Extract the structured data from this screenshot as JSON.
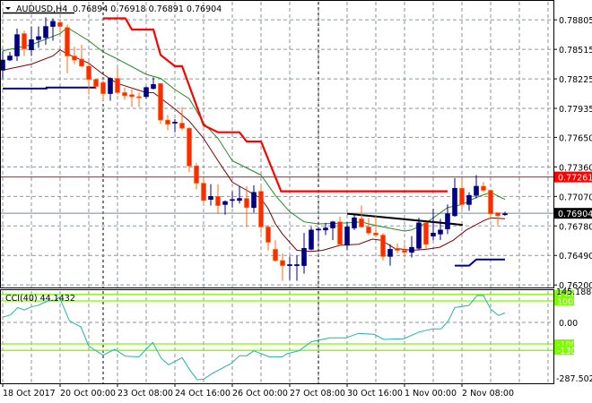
{
  "header": {
    "symbol": "AUDUSD,H4",
    "ohlc": "0.76894 0.76918 0.76891 0.76904"
  },
  "colors": {
    "bull": "#000080",
    "bear": "#ff2a00",
    "bear_wick": "#ff6a10",
    "ma_fast": "#1f8a1f",
    "ma_slow": "#7a0000",
    "resistance_step": "#ff0000",
    "support_step": "#00008b",
    "cci_line": "#20b2aa",
    "cci_levels": "#7cfc00"
  },
  "chart_data": [
    {
      "type": "candlestick",
      "title": "AUDUSD,H4",
      "price_axis_ticks": [
        "0.78805",
        "0.78515",
        "0.78225",
        "0.77935",
        "0.77650",
        "0.77360",
        "0.77070",
        "0.76780",
        "0.76490",
        "0.76200"
      ],
      "ylim": [
        0.762,
        0.79
      ],
      "x_tick_labels": [
        "18 Oct 2017",
        "20 Oct 00:00",
        "23 Oct 08:00",
        "24 Oct 16:00",
        "26 Oct 00:00",
        "27 Oct 08:00",
        "30 Oct 16:00",
        "1 Nov 00:00",
        "2 Nov 08:00"
      ],
      "x_tick_bars": [
        0,
        8,
        16,
        24,
        32,
        40,
        48,
        56,
        64
      ],
      "candles_ohlc": [
        [
          0.7831,
          0.785,
          0.7823,
          0.7841
        ],
        [
          0.7841,
          0.7849,
          0.784,
          0.7845
        ],
        [
          0.7845,
          0.7872,
          0.784,
          0.7866
        ],
        [
          0.7867,
          0.787,
          0.7845,
          0.7852
        ],
        [
          0.7851,
          0.7874,
          0.7845,
          0.7861
        ],
        [
          0.7861,
          0.7874,
          0.7853,
          0.7864
        ],
        [
          0.7863,
          0.7883,
          0.7856,
          0.7874
        ],
        [
          0.7874,
          0.7882,
          0.786,
          0.7879
        ],
        [
          0.7878,
          0.7881,
          0.7868,
          0.7874
        ],
        [
          0.7873,
          0.7876,
          0.7828,
          0.7845
        ],
        [
          0.7845,
          0.7854,
          0.7837,
          0.7841
        ],
        [
          0.7842,
          0.7856,
          0.7834,
          0.7835
        ],
        [
          0.7835,
          0.784,
          0.7807,
          0.7822
        ],
        [
          0.7822,
          0.7823,
          0.7812,
          0.7815
        ],
        [
          0.7819,
          0.7821,
          0.7801,
          0.7808
        ],
        [
          0.7808,
          0.7824,
          0.7801,
          0.7823
        ],
        [
          0.7823,
          0.7834,
          0.7807,
          0.7809
        ],
        [
          0.7809,
          0.7814,
          0.7802,
          0.7806
        ],
        [
          0.7807,
          0.7812,
          0.7795,
          0.7805
        ],
        [
          0.7805,
          0.7809,
          0.7795,
          0.7804
        ],
        [
          0.7805,
          0.7815,
          0.7803,
          0.7814
        ],
        [
          0.7813,
          0.7824,
          0.7812,
          0.7817
        ],
        [
          0.7818,
          0.7818,
          0.7778,
          0.7782
        ],
        [
          0.7782,
          0.7787,
          0.7772,
          0.7778
        ],
        [
          0.7779,
          0.7783,
          0.777,
          0.778
        ],
        [
          0.7779,
          0.7795,
          0.7772,
          0.7774
        ],
        [
          0.7774,
          0.7775,
          0.7731,
          0.7737
        ],
        [
          0.7737,
          0.774,
          0.7714,
          0.772
        ],
        [
          0.772,
          0.7724,
          0.7701,
          0.7703
        ],
        [
          0.7704,
          0.7719,
          0.7698,
          0.7707
        ],
        [
          0.7707,
          0.7719,
          0.769,
          0.7698
        ],
        [
          0.7699,
          0.7703,
          0.7689,
          0.7702
        ],
        [
          0.7703,
          0.7712,
          0.7696,
          0.7704
        ],
        [
          0.7703,
          0.7717,
          0.77,
          0.7705
        ],
        [
          0.7705,
          0.7717,
          0.7677,
          0.7696
        ],
        [
          0.7696,
          0.7718,
          0.7691,
          0.7711
        ],
        [
          0.7712,
          0.7718,
          0.7671,
          0.7677
        ],
        [
          0.7677,
          0.7679,
          0.7654,
          0.7662
        ],
        [
          0.7655,
          0.7664,
          0.7643,
          0.7644
        ],
        [
          0.7644,
          0.7651,
          0.7624,
          0.7639
        ],
        [
          0.7639,
          0.7648,
          0.7625,
          0.764
        ],
        [
          0.7639,
          0.7649,
          0.7624,
          0.764
        ],
        [
          0.7639,
          0.7671,
          0.7631,
          0.7656
        ],
        [
          0.7655,
          0.7677,
          0.7654,
          0.7674
        ],
        [
          0.7674,
          0.7677,
          0.7663,
          0.7675
        ],
        [
          0.7674,
          0.7681,
          0.7669,
          0.7676
        ],
        [
          0.7676,
          0.7683,
          0.7664,
          0.7682
        ],
        [
          0.7682,
          0.7687,
          0.7659,
          0.766
        ],
        [
          0.7659,
          0.7682,
          0.7654,
          0.7677
        ],
        [
          0.7676,
          0.769,
          0.7674,
          0.7686
        ],
        [
          0.7685,
          0.7698,
          0.7676,
          0.7677
        ],
        [
          0.7677,
          0.7686,
          0.7669,
          0.7671
        ],
        [
          0.7671,
          0.7688,
          0.7668,
          0.7669
        ],
        [
          0.7669,
          0.7671,
          0.7644,
          0.7648
        ],
        [
          0.7648,
          0.766,
          0.7639,
          0.7655
        ],
        [
          0.7656,
          0.7661,
          0.7651,
          0.7654
        ],
        [
          0.7654,
          0.766,
          0.7647,
          0.7652
        ],
        [
          0.7652,
          0.7668,
          0.7647,
          0.7657
        ],
        [
          0.7656,
          0.7686,
          0.7654,
          0.7681
        ],
        [
          0.7681,
          0.7682,
          0.7655,
          0.766
        ],
        [
          0.7668,
          0.7695,
          0.7664,
          0.7671
        ],
        [
          0.767,
          0.7685,
          0.7664,
          0.7674
        ],
        [
          0.7675,
          0.7699,
          0.767,
          0.769
        ],
        [
          0.7688,
          0.7725,
          0.7687,
          0.7715
        ],
        [
          0.7715,
          0.7725,
          0.7695,
          0.7699
        ],
        [
          0.7699,
          0.7711,
          0.7693,
          0.7708
        ],
        [
          0.7708,
          0.7728,
          0.7705,
          0.7717
        ],
        [
          0.7717,
          0.7721,
          0.7711,
          0.7713
        ],
        [
          0.7713,
          0.7714,
          0.7684,
          0.769
        ],
        [
          0.7691,
          0.7691,
          0.7679,
          0.7688
        ],
        [
          0.7689,
          0.7692,
          0.7688,
          0.769
        ]
      ],
      "ma_fast": [
        [
          0,
          0.785
        ],
        [
          4,
          0.7856
        ],
        [
          8,
          0.7867
        ],
        [
          9,
          0.7873
        ],
        [
          12,
          0.786
        ],
        [
          14,
          0.7849
        ],
        [
          16,
          0.7842
        ],
        [
          20,
          0.7827
        ],
        [
          22,
          0.7823
        ],
        [
          24,
          0.7812
        ],
        [
          26,
          0.7803
        ],
        [
          28,
          0.7779
        ],
        [
          30,
          0.7764
        ],
        [
          32,
          0.7742
        ],
        [
          34,
          0.7735
        ],
        [
          36,
          0.7728
        ],
        [
          38,
          0.7708
        ],
        [
          40,
          0.7692
        ],
        [
          42,
          0.7682
        ],
        [
          44,
          0.768
        ],
        [
          48,
          0.7681
        ],
        [
          50,
          0.7682
        ],
        [
          51,
          0.768
        ],
        [
          53,
          0.7677
        ],
        [
          56,
          0.7673
        ],
        [
          57,
          0.7674
        ],
        [
          59,
          0.7681
        ],
        [
          62,
          0.7696
        ],
        [
          64,
          0.7699
        ],
        [
          66,
          0.7706
        ],
        [
          68,
          0.7711
        ],
        [
          70,
          0.7704
        ]
      ],
      "ma_slow": [
        [
          0,
          0.7831
        ],
        [
          4,
          0.7837
        ],
        [
          7,
          0.7845
        ],
        [
          8,
          0.7851
        ],
        [
          9,
          0.7847
        ],
        [
          12,
          0.7838
        ],
        [
          14,
          0.7827
        ],
        [
          16,
          0.7818
        ],
        [
          20,
          0.7809
        ],
        [
          21,
          0.7809
        ],
        [
          24,
          0.7793
        ],
        [
          26,
          0.7781
        ],
        [
          28,
          0.7764
        ],
        [
          30,
          0.7742
        ],
        [
          32,
          0.7721
        ],
        [
          34,
          0.7713
        ],
        [
          36,
          0.7705
        ],
        [
          37,
          0.7695
        ],
        [
          38,
          0.768
        ],
        [
          39,
          0.767
        ],
        [
          40,
          0.7662
        ],
        [
          41,
          0.7654
        ],
        [
          43,
          0.7653
        ],
        [
          44.6,
          0.7654
        ],
        [
          47,
          0.7659
        ],
        [
          49.6,
          0.766
        ],
        [
          51.5,
          0.7665
        ],
        [
          52.8,
          0.7664
        ],
        [
          54.6,
          0.7656
        ],
        [
          57,
          0.7654
        ],
        [
          59,
          0.7655
        ],
        [
          60.9,
          0.7657
        ],
        [
          62.8,
          0.7664
        ],
        [
          64.6,
          0.7674
        ],
        [
          67,
          0.7683
        ],
        [
          68,
          0.7686
        ],
        [
          70,
          0.7685
        ]
      ],
      "resistance_step": [
        [
          14,
          0.7882
        ],
        [
          17.1,
          0.7882
        ],
        [
          18,
          0.7871
        ],
        [
          21,
          0.7871
        ],
        [
          22,
          0.7846
        ],
        [
          24,
          0.7835
        ],
        [
          25,
          0.7835
        ],
        [
          28,
          0.7777
        ],
        [
          30,
          0.777
        ],
        [
          33,
          0.777
        ],
        [
          34,
          0.7761
        ],
        [
          36,
          0.7761
        ],
        [
          38.8,
          0.7712
        ],
        [
          62,
          0.7712
        ]
      ],
      "support_step": [
        [
          [
            0,
            0.7813
          ],
          [
            6.1,
            0.7813
          ],
          [
            6.1,
            0.7814
          ],
          [
            13,
            0.7814
          ]
        ],
        [
          [
            63,
            0.7639
          ],
          [
            65,
            0.7639
          ],
          [
            66,
            0.7645
          ],
          [
            70,
            0.7645
          ]
        ]
      ],
      "trendline": [
        [
          48,
          0.769
        ],
        [
          64.1,
          0.7679
        ]
      ],
      "horizontal_line": {
        "price": 0.77261,
        "label": "0.77261"
      },
      "current_price": {
        "price": 0.76904,
        "label": "0.76904"
      }
    },
    {
      "type": "line",
      "title": "CCI(40) 44.1432",
      "ylim": [
        -287.5026,
        145.1888
      ],
      "y_labels": {
        "max": "145.1888",
        "zero": "0.00",
        "min": "-287.5026"
      },
      "levels": [
        {
          "value": 130,
          "label": "130"
        },
        {
          "value": 100,
          "label": "100"
        },
        {
          "value": -100,
          "label": "-100"
        },
        {
          "value": -130,
          "label": "-130"
        }
      ],
      "points": [
        [
          0,
          24
        ],
        [
          1.1,
          35
        ],
        [
          2.1,
          69
        ],
        [
          3,
          58
        ],
        [
          4,
          72
        ],
        [
          5,
          80
        ],
        [
          6.3,
          100
        ],
        [
          7.4,
          104
        ],
        [
          7.9,
          118
        ],
        [
          9.3,
          7
        ],
        [
          10.9,
          -21
        ],
        [
          12,
          -111
        ],
        [
          14,
          -153
        ],
        [
          15.6,
          -125
        ],
        [
          17.1,
          -157
        ],
        [
          19,
          -160
        ],
        [
          20.9,
          -93
        ],
        [
          22.1,
          -167
        ],
        [
          23.1,
          -197
        ],
        [
          25,
          -164
        ],
        [
          26.1,
          -222
        ],
        [
          27.1,
          -267
        ],
        [
          28,
          -264
        ],
        [
          29.3,
          -236
        ],
        [
          31.8,
          -192
        ],
        [
          33,
          -155
        ],
        [
          34,
          -155
        ],
        [
          35,
          -132
        ],
        [
          37.1,
          -160
        ],
        [
          39,
          -160
        ],
        [
          39.6,
          -146
        ],
        [
          41.3,
          -132
        ],
        [
          43,
          -90
        ],
        [
          45.6,
          -72
        ],
        [
          47.8,
          -72
        ],
        [
          49.6,
          -51
        ],
        [
          51.8,
          -56
        ],
        [
          53.1,
          -79
        ],
        [
          55.9,
          -76
        ],
        [
          58,
          -45
        ],
        [
          59.9,
          -30
        ],
        [
          61.1,
          -30
        ],
        [
          62.1,
          7
        ],
        [
          63,
          69
        ],
        [
          65,
          79
        ],
        [
          66.1,
          125
        ],
        [
          67,
          125
        ],
        [
          68,
          62
        ],
        [
          69.1,
          32
        ],
        [
          70,
          44.1432
        ]
      ]
    }
  ]
}
